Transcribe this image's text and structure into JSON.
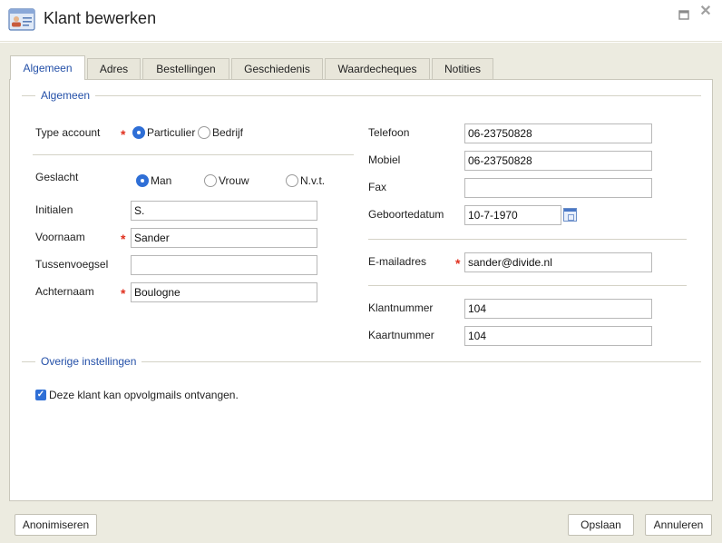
{
  "window": {
    "title": "Klant bewerken",
    "icon": "contact-card-icon"
  },
  "tabs": [
    {
      "label": "Algemeen",
      "active": true
    },
    {
      "label": "Adres",
      "active": false
    },
    {
      "label": "Bestellingen",
      "active": false
    },
    {
      "label": "Geschiedenis",
      "active": false
    },
    {
      "label": "Waardecheques",
      "active": false
    },
    {
      "label": "Notities",
      "active": false
    }
  ],
  "sections": {
    "general": "Algemeen",
    "other": "Overige instellingen"
  },
  "left": {
    "type_account": {
      "label": "Type account",
      "options": [
        "Particulier",
        "Bedrijf"
      ],
      "selected": "Particulier"
    },
    "gender": {
      "label": "Geslacht",
      "options": [
        "Man",
        "Vrouw",
        "N.v.t."
      ],
      "selected": "Man"
    },
    "initials": {
      "label": "Initialen",
      "value": "S."
    },
    "first_name": {
      "label": "Voornaam",
      "value": "Sander"
    },
    "middle_name": {
      "label": "Tussenvoegsel",
      "value": ""
    },
    "last_name": {
      "label": "Achternaam",
      "value": "Boulogne"
    }
  },
  "right": {
    "phone": {
      "label": "Telefoon",
      "value": "06-23750828"
    },
    "mobile": {
      "label": "Mobiel",
      "value": "06-23750828"
    },
    "fax": {
      "label": "Fax",
      "value": ""
    },
    "birthdate": {
      "label": "Geboortedatum",
      "value": "10-7-1970"
    },
    "email": {
      "label": "E-mailadres",
      "value": "sander@divide.nl"
    },
    "customer_number": {
      "label": "Klantnummer",
      "value": "104"
    },
    "card_number": {
      "label": "Kaartnummer",
      "value": "104"
    }
  },
  "followup_mails": {
    "label": "Deze klant kan opvolgmails ontvangen.",
    "checked": true
  },
  "footer": {
    "anonymize": "Anonimiseren",
    "save": "Opslaan",
    "cancel": "Annuleren"
  },
  "colors": {
    "accent": "#2450a8",
    "required": "#e0301e",
    "background": "#ecebe0"
  }
}
